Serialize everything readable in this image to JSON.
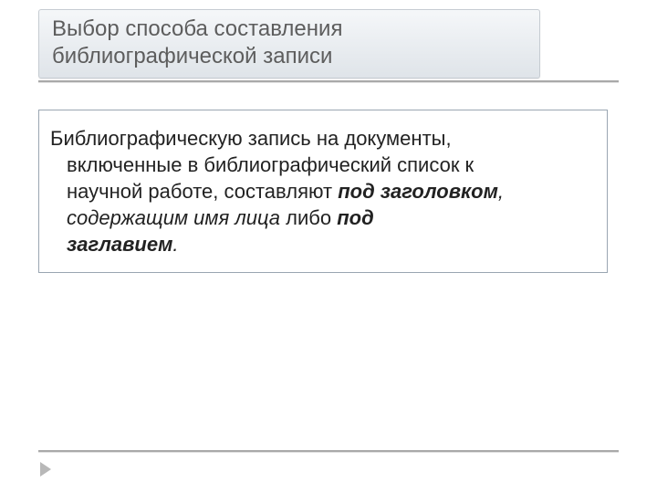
{
  "title": "Выбор способа составления библиографической записи",
  "body": {
    "lead": "Библиографическую запись на документы,",
    "line2a": "включенные в библиографический список к",
    "line3a": "научной работе,  составляют  ",
    "h1": "под заголовком",
    "comma": ", ",
    "line4a": "содержащим имя лица",
    "line4b": " либо            ",
    "h2": "под",
    "h3": "заглавием",
    "period": "."
  }
}
